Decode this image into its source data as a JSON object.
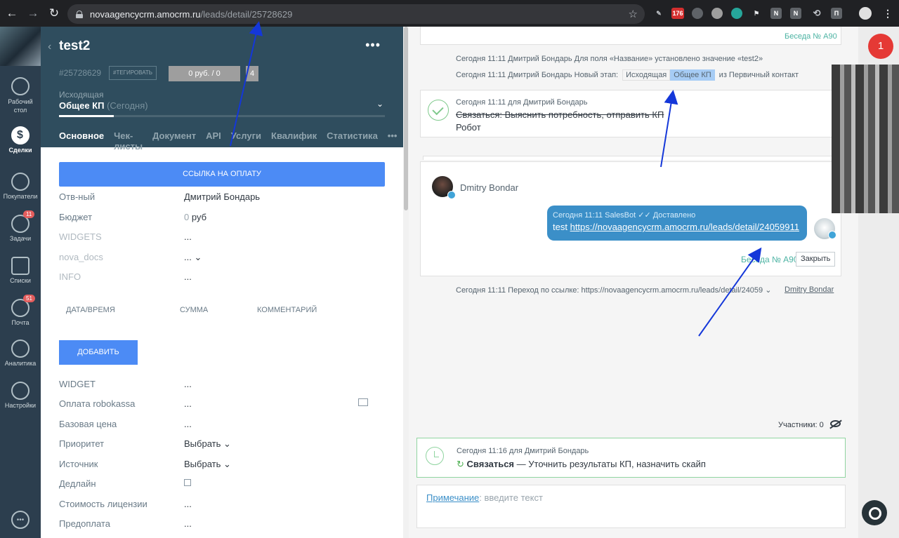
{
  "browser": {
    "url_host": "novaagencycrm.amocrm.ru",
    "url_path": "/leads/detail/25728629",
    "ext_badge": "176",
    "extensions": [
      "N",
      "N",
      "П"
    ]
  },
  "sidebar": {
    "items": [
      {
        "label": "Рабочий стол",
        "icon": "dashboard-icon"
      },
      {
        "label": "Сделки",
        "icon": "deals-icon",
        "active": true
      },
      {
        "label": "Покупатели",
        "icon": "customers-icon"
      },
      {
        "label": "Задачи",
        "icon": "tasks-icon",
        "badge": "11"
      },
      {
        "label": "Списки",
        "icon": "lists-icon"
      },
      {
        "label": "Почта",
        "icon": "mail-icon",
        "badge": "51"
      },
      {
        "label": "Аналитика",
        "icon": "analytics-icon"
      },
      {
        "label": "Настройки",
        "icon": "settings-icon"
      }
    ]
  },
  "lead": {
    "title": "test2",
    "id": "#25728629",
    "tag_button": "#ТЕГИРОВАТЬ",
    "budget_label": "0 руб. / 0",
    "count": "4",
    "pipeline": "Исходящая",
    "stage": "Общее КП",
    "stage_when": "(Сегодня)",
    "tabs": [
      "Основное",
      "Чек-листы",
      "Документ",
      "API",
      "Услуги",
      "Квалифик",
      "Статистика"
    ],
    "pay_button": "ССЫЛКА НА ОПЛАТУ",
    "fields_top": [
      {
        "key": "Отв-ный",
        "value": "Дмитрий Бондарь"
      },
      {
        "key": "Бюджет",
        "value_gray": "0",
        "value": "руб"
      },
      {
        "key": "WIDGETS",
        "value": "...",
        "muted": true
      },
      {
        "key": "nova_docs",
        "value": "... ⌄",
        "muted": true
      },
      {
        "key": "INFO",
        "value": "...",
        "muted": true
      }
    ],
    "columns": [
      "ДАТА/ВРЕМЯ",
      "СУММА",
      "КОММЕНТАРИЙ"
    ],
    "add_button": "ДОБАВИТЬ",
    "fields_bottom": [
      {
        "key": "WIDGET",
        "value": "..."
      },
      {
        "key": "Оплата robokassa",
        "value": "..."
      },
      {
        "key": "Базовая цена",
        "value": "..."
      },
      {
        "key": "Приоритет",
        "value": "Выбрать ⌄"
      },
      {
        "key": "Источник",
        "value": "Выбрать ⌄"
      },
      {
        "key": "Дедлайн",
        "value": ""
      },
      {
        "key": "Стоимость лицензии",
        "value": "..."
      },
      {
        "key": "Предоплата",
        "value": "..."
      }
    ]
  },
  "feed": {
    "top_besa": "Беседа № А90",
    "event1": "Сегодня 11:11 Дмитрий Бондарь  Для поля «Название» установлено значение «test2»",
    "event2_prefix": "Сегодня 11:11 Дмитрий Бондарь  Новый этап:",
    "event2_from": "Исходящая",
    "event2_to": "Общее КП",
    "event2_suffix": "из Первичный контакт",
    "task_meta": "Сегодня 11:11  для Дмитрий Бондарь",
    "task_text": "Связаться: Выяснить потребность, отправить КП",
    "task_author": "Робот",
    "msg_author": "Dmitry Bondar",
    "msg_meta": "Сегодня 11:11 SalesBot ✓✓ Доставлено",
    "msg_text": "test",
    "msg_link": "https://novaagencycrm.amocrm.ru/leads/detail/24059911",
    "besa": "Беседа № А90",
    "close_button": "Закрыть",
    "transition": "Сегодня 11:11 Переход по ссылке: https://novaagencycrm.amocrm.ru/leads/detail/24059 ⌄",
    "transition_user": "Dmitry Bondar",
    "participants": "Участники: 0",
    "next_meta": "Сегодня 11:16 для Дмитрий Бондарь",
    "next_type": "Связаться",
    "next_text": " — Уточнить результаты КП, назначить скайп",
    "note_label": "Примечание",
    "note_placeholder": ": введите текст"
  },
  "notifications": "1"
}
